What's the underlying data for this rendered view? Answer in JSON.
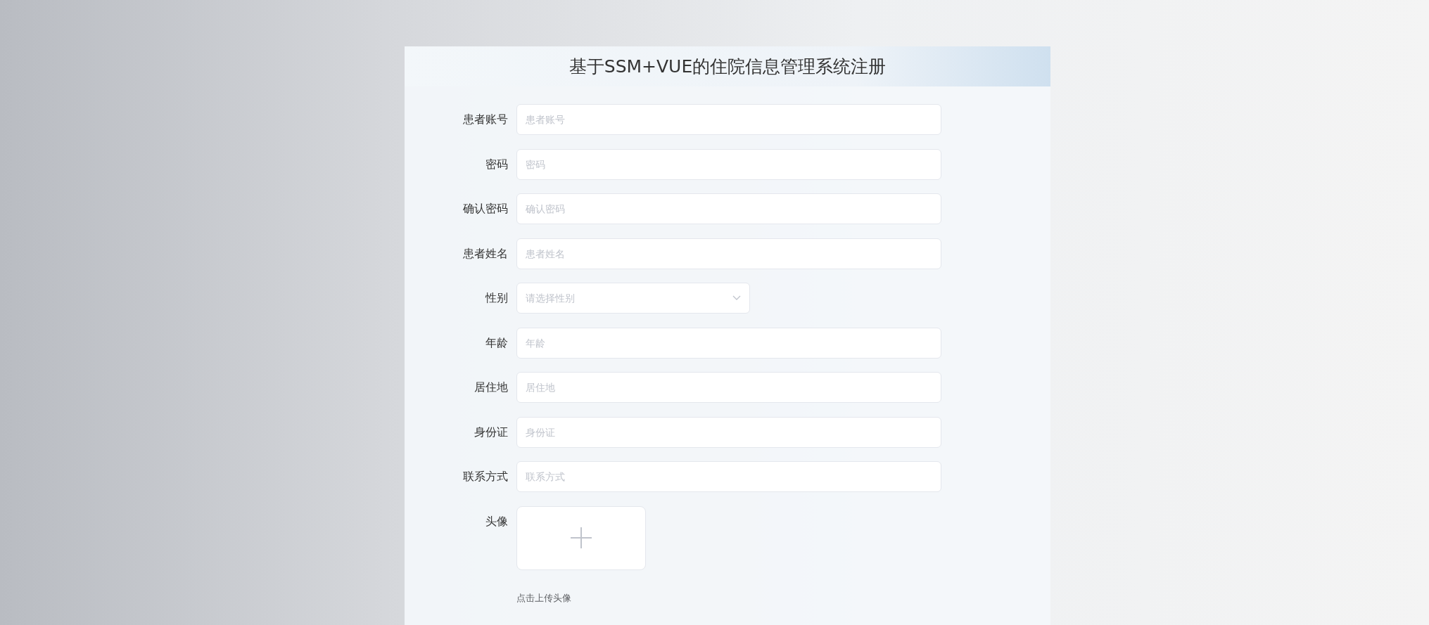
{
  "title": "基于SSM+VUE的住院信息管理系统注册",
  "fields": [
    {
      "kind": "input",
      "label": "患者账号",
      "placeholder": "患者账号"
    },
    {
      "kind": "input",
      "label": "密码",
      "placeholder": "密码"
    },
    {
      "kind": "input",
      "label": "确认密码",
      "placeholder": "确认密码"
    },
    {
      "kind": "input",
      "label": "患者姓名",
      "placeholder": "患者姓名"
    },
    {
      "kind": "select",
      "label": "性别",
      "placeholder": "请选择性别"
    },
    {
      "kind": "input",
      "label": "年龄",
      "placeholder": "年龄"
    },
    {
      "kind": "input",
      "label": "居住地",
      "placeholder": "居住地"
    },
    {
      "kind": "input",
      "label": "身份证",
      "placeholder": "身份证"
    },
    {
      "kind": "input",
      "label": "联系方式",
      "placeholder": "联系方式"
    },
    {
      "kind": "upload",
      "label": "头像",
      "hint": "点击上传头像"
    }
  ]
}
